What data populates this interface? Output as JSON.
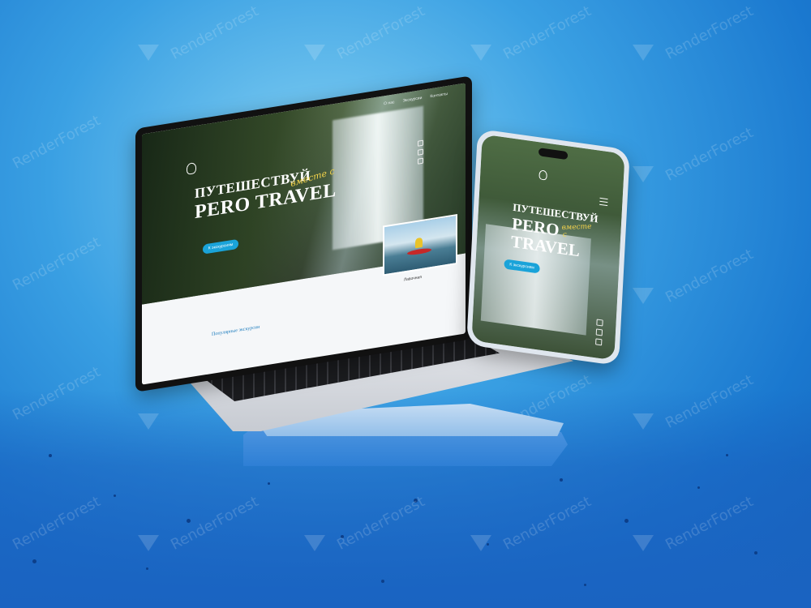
{
  "watermark": {
    "brand_text": "RenderForest"
  },
  "laptop": {
    "nav_links": [
      "О нас",
      "Экскурсии",
      "Контакты"
    ],
    "hero": {
      "title_line1": "ПУТЕШЕСТВУЙ",
      "title_script": "вместе с",
      "title_line2": "PERO TRAVEL",
      "cta_label": "К экскурсиям"
    },
    "section_label": "Лавочная",
    "popular_label": "Популярные экскурсии"
  },
  "phone": {
    "hero": {
      "title_line1": "ПУТЕШЕСТВУЙ",
      "title_script": "вместе с",
      "title_line2": "PERO",
      "title_line3": "TRAVEL",
      "cta_label": "К экскурсиям"
    }
  },
  "colors": {
    "accent": "#1aa3d9",
    "script_gold": "#f3d24a",
    "background": "#3aa0e3"
  }
}
